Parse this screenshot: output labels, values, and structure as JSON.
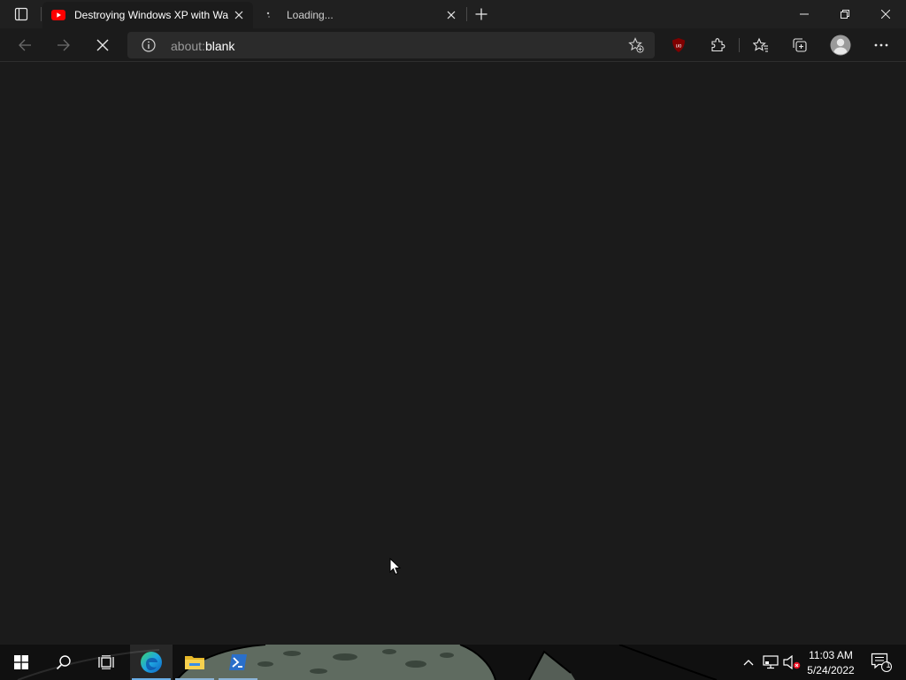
{
  "browser": {
    "tabs": [
      {
        "title": "Destroying Windows XP with Wa",
        "favicon": "youtube-icon",
        "active": true
      },
      {
        "title": "Loading...",
        "favicon": "loading-spinner-icon",
        "active": false
      }
    ],
    "address": {
      "dim": "about:",
      "main": "blank"
    },
    "toolbar_icons": [
      "back-icon",
      "forward-icon",
      "stop-icon",
      "info-icon",
      "add-favorite-icon",
      "ublock-icon",
      "extensions-icon",
      "favorites-icon",
      "collections-icon",
      "profile-icon",
      "more-icon"
    ],
    "window_controls": [
      "minimize-icon",
      "restore-icon",
      "close-icon"
    ]
  },
  "taskbar": {
    "apps": [
      "start-icon",
      "search-icon",
      "task-view-icon",
      "edge-icon",
      "file-explorer-icon",
      "powershell-icon"
    ],
    "tray_icons": [
      "show-hidden-icons-chevron",
      "network-icon",
      "volume-muted-icon"
    ],
    "clock": {
      "time": "11:03 AM",
      "date": "5/24/2022"
    },
    "notifications": {
      "count": "1"
    }
  },
  "colors": {
    "background": "#1b1b1b",
    "tabstrip": "#202020",
    "addressbar": "#2b2b2b",
    "taskbar": "#101010",
    "youtube_red": "#ff0000",
    "ublock_red": "#800000",
    "edge_active": "#6aaee6"
  }
}
